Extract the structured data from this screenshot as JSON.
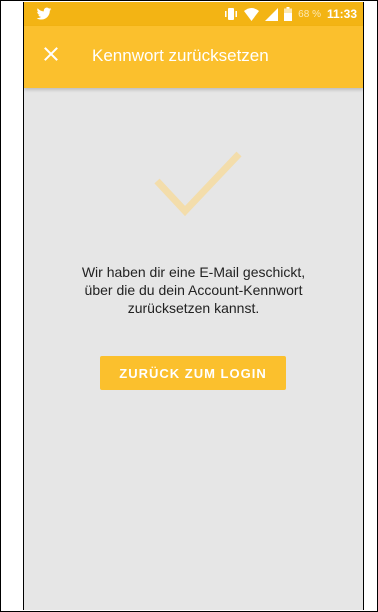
{
  "status_bar": {
    "battery_percent": "68 %",
    "time": "11:33",
    "icons": [
      "twitter-icon",
      "vibrate-icon",
      "wifi-icon",
      "signal-icon",
      "battery-icon"
    ]
  },
  "app_bar": {
    "close_icon": "close-icon",
    "title": "Kennwort zurücksetzen"
  },
  "content": {
    "success_icon": "checkmark-icon",
    "message_lines": [
      "Wir haben dir eine E-Mail geschickt,",
      "über die du dein Account-Kennwort",
      "zurücksetzen kannst."
    ],
    "button_label": "ZURÜCK ZUM LOGIN"
  },
  "colors": {
    "status_bar": "#f3b414",
    "app_bar": "#fbc02d",
    "background": "#e6e6e6",
    "checkmark": "#f3ddab",
    "button": "#fbc02d"
  }
}
